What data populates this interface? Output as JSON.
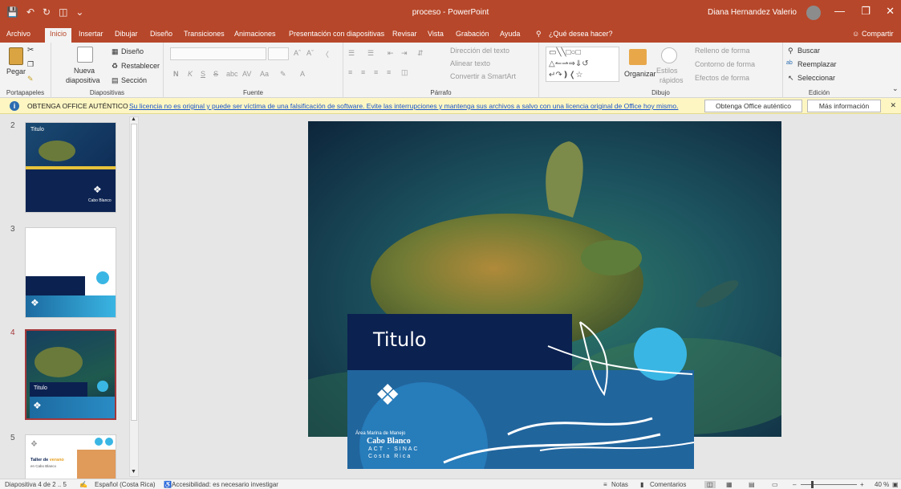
{
  "titlebar": {
    "document": "proceso",
    "separator": "-",
    "app": "PowerPoint",
    "user": "Diana Hernandez Valerio"
  },
  "tabs": [
    "Archivo",
    "Inicio",
    "Insertar",
    "Dibujar",
    "Diseño",
    "Transiciones",
    "Animaciones",
    "Presentación con diapositivas",
    "Revisar",
    "Vista",
    "Grabación",
    "Ayuda"
  ],
  "tell_me": "¿Qué desea hacer?",
  "share": "Compartir",
  "ribbon": {
    "clipboard": {
      "paste": "Pegar",
      "label": "Portapapeles"
    },
    "slides": {
      "new_slide_1": "Nueva",
      "new_slide_2": "diapositiva",
      "layout": "Diseño",
      "reset": "Restablecer",
      "section": "Sección",
      "label": "Diapositivas"
    },
    "font": {
      "label": "Fuente",
      "bold": "N",
      "italic": "K",
      "underline": "S",
      "strike": "S"
    },
    "paragraph": {
      "text_direction": "Dirección del texto",
      "align_text": "Alinear texto",
      "smartart": "Convertir a SmartArt",
      "label": "Párrafo"
    },
    "drawing": {
      "arrange": "Organizar",
      "styles_1": "Estilos",
      "styles_2": "rápidos",
      "fill": "Relleno de forma",
      "outline": "Contorno de forma",
      "effects": "Efectos de forma",
      "label": "Dibujo"
    },
    "editing": {
      "find": "Buscar",
      "replace": "Reemplazar",
      "select": "Seleccionar",
      "label": "Edición"
    }
  },
  "message_bar": {
    "title": "OBTENGA OFFICE AUTÉNTICO",
    "text": "Su licencia no es original y puede ser víctima de una falsificación de software. Evite las interrupciones y mantenga sus archivos a salvo con una licencia original de Office hoy mismo.",
    "button_1": "Obtenga Office auténtico",
    "button_2": "Más información"
  },
  "thumbnails": [
    {
      "number": "2",
      "title": "Titulo",
      "org_1": "Cabo Blanco"
    },
    {
      "number": "3"
    },
    {
      "number": "4",
      "title": "Titulo"
    },
    {
      "number": "5",
      "heading_1": "Taller de",
      "heading_accent": "verano",
      "sub": "en Cabo Blanco"
    }
  ],
  "slide": {
    "title": "Titulo",
    "org_area": "Área Marina de Manejo",
    "org_name": "Cabo Blanco",
    "org_act": "ACT - SINAC",
    "org_country": "Costa Rica"
  },
  "status": {
    "slide_info": "Diapositiva 4 de 2 .. 5",
    "language": "Español (Costa Rica)",
    "accessibility": "Accesibilidad: es necesario investigar",
    "notes": "Notas",
    "comments": "Comentarios",
    "zoom": "40 %"
  },
  "colors": {
    "accent": "#b7472a",
    "navy": "#0b2150",
    "teal": "#1c6aa0",
    "sun": "#3ab6e4"
  }
}
